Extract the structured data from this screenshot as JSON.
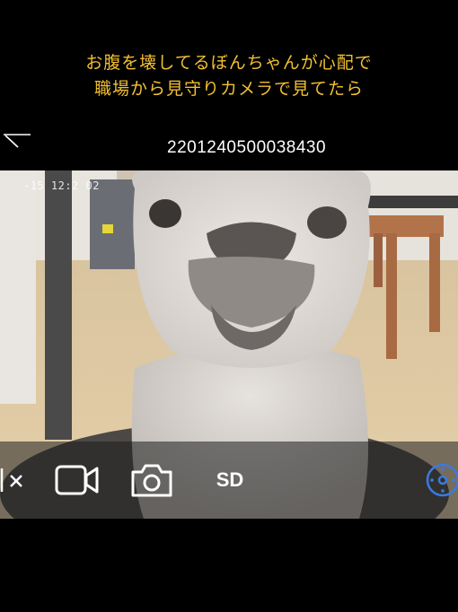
{
  "caption": {
    "line1": "お腹を壊してるぼんちゃんが心配で",
    "line2": "職場から見守りカメラで見てたら",
    "color": "#f2c033"
  },
  "header": {
    "back_icon": "back-arrow-icon",
    "device_id": "2201240500038430"
  },
  "video": {
    "timestamp": "-15  12:2  02"
  },
  "controls": {
    "mute_icon": "speaker-mute-icon",
    "record_icon": "video-camera-icon",
    "snapshot_icon": "camera-icon",
    "sd_label": "SD",
    "ptz_icon": "ptz-control-icon",
    "accent": "#3a7be0"
  }
}
